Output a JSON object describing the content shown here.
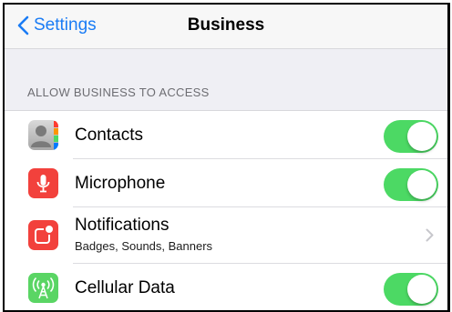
{
  "nav": {
    "back_label": "Settings",
    "title": "Business"
  },
  "section": {
    "header": "ALLOW BUSINESS TO ACCESS"
  },
  "rows": [
    {
      "label": "Contacts",
      "icon": "contacts-icon",
      "control": "toggle",
      "on": true
    },
    {
      "label": "Microphone",
      "icon": "microphone-icon",
      "control": "toggle",
      "on": true
    },
    {
      "label": "Notifications",
      "sublabel": "Badges, Sounds, Banners",
      "icon": "notifications-icon",
      "control": "chevron"
    },
    {
      "label": "Cellular Data",
      "icon": "cellular-data-icon",
      "control": "toggle",
      "on": true
    }
  ],
  "colors": {
    "accent": "#1a7cf5",
    "toggle_on": "#4cd964",
    "microphone_icon_bg": "#f2413c",
    "notifications_icon_bg": "#f2413c",
    "cellular_icon_bg": "#5ad564",
    "background": "#efeff4"
  }
}
